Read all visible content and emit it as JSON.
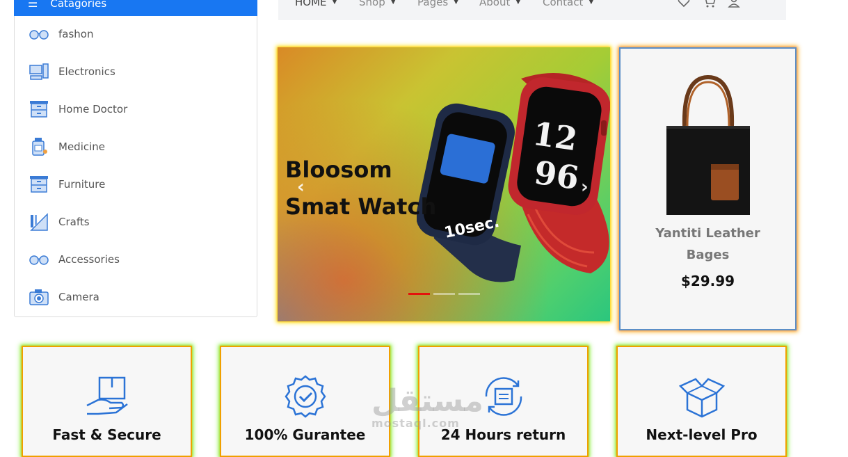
{
  "sidebar": {
    "header": "Catagories",
    "items": [
      {
        "label": "fashon",
        "icon": "glasses-icon"
      },
      {
        "label": "Electronics",
        "icon": "computer-icon"
      },
      {
        "label": "Home Doctor",
        "icon": "cabinet-icon"
      },
      {
        "label": "Medicine",
        "icon": "medicine-bottle-icon"
      },
      {
        "label": "Furniture",
        "icon": "drawer-icon"
      },
      {
        "label": "Crafts",
        "icon": "ruler-pencil-icon"
      },
      {
        "label": "Accessories",
        "icon": "glasses-icon"
      },
      {
        "label": "Camera",
        "icon": "camera-icon"
      }
    ]
  },
  "nav": {
    "items": [
      "HOME",
      "Shop",
      "Pages",
      "About",
      "Contact"
    ],
    "icons": [
      "heart-icon",
      "cart-icon",
      "user-icon"
    ]
  },
  "hero": {
    "title_line1": "Bloosom",
    "title_line2": "Smat Watch",
    "prev": "‹",
    "next": "›",
    "indicators": 3,
    "active_indicator": 0
  },
  "product": {
    "name": "Yantiti Leather Bages",
    "price": "$29.99"
  },
  "features": [
    {
      "label": "Fast & Secure",
      "icon": "box-hand-icon"
    },
    {
      "label": "100% Gurantee",
      "icon": "badge-check-icon"
    },
    {
      "label": "24 Hours return",
      "icon": "return-box-icon"
    },
    {
      "label": "Next-level Pro",
      "icon": "open-box-icon"
    }
  ],
  "watermark": {
    "arabic": "مستقل",
    "latin": "mostaql.com"
  },
  "colors": {
    "accent": "#1877f2",
    "icon_blue": "#2b73d6",
    "indicator_active": "#e4120d"
  }
}
